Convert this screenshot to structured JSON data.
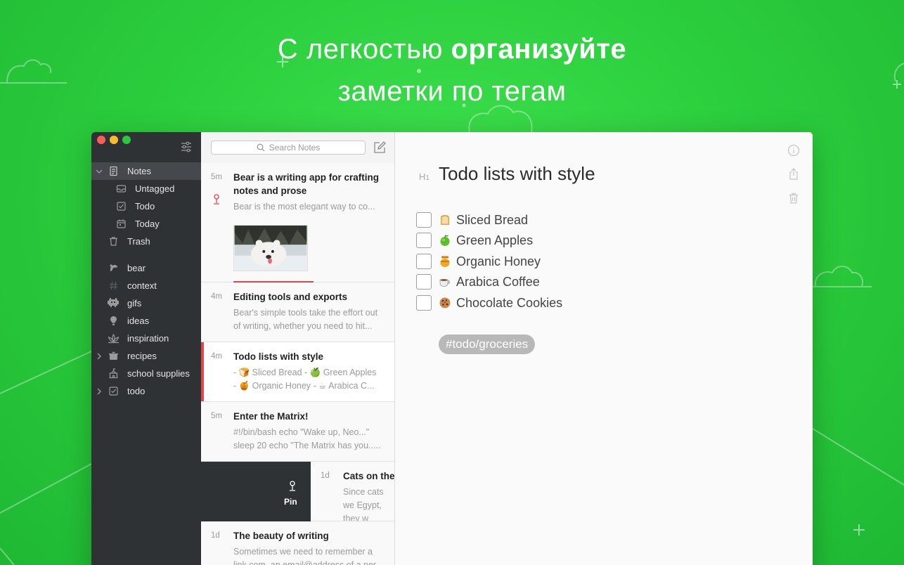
{
  "headline": {
    "line1_regular": "С легкостью ",
    "line1_bold": "организуйте",
    "line2": "заметки по тегам"
  },
  "sidebar": {
    "items": [
      {
        "label": "Notes",
        "icon": "note-icon"
      },
      {
        "label": "Untagged",
        "icon": "inbox-icon"
      },
      {
        "label": "Todo",
        "icon": "checkbox-icon"
      },
      {
        "label": "Today",
        "icon": "calendar-icon"
      },
      {
        "label": "Trash",
        "icon": "trash-icon"
      },
      {
        "label": "bear",
        "icon": "bear-icon"
      },
      {
        "label": "context",
        "icon": "hash-icon"
      },
      {
        "label": "gifs",
        "icon": "space-invader-icon"
      },
      {
        "label": "ideas",
        "icon": "lightbulb-icon"
      },
      {
        "label": "inspiration",
        "icon": "lotus-icon"
      },
      {
        "label": "recipes",
        "icon": "pot-icon"
      },
      {
        "label": "school supplies",
        "icon": "school-icon"
      },
      {
        "label": "todo",
        "icon": "checkbox-icon"
      }
    ]
  },
  "list": {
    "search_placeholder": "Search Notes",
    "notes": [
      {
        "time": "5m",
        "title": "Bear is a writing app for crafting notes and prose",
        "snippet": "Bear is the most elegant way to co..."
      },
      {
        "time": "4m",
        "title": "Editing tools and exports",
        "snippet": "Bear's simple tools take the effort out of writing, whether you need to hit..."
      },
      {
        "time": "4m",
        "title": "Todo lists with style",
        "snippet1": "- 🍞 Sliced Bread - 🍏 Green Apples",
        "snippet2": "- 🍯 Organic Honey - ☕ Arabica C..."
      },
      {
        "time": "5m",
        "title": "Enter the Matrix!",
        "snippet": "#!/bin/bash echo \"Wake up, Neo...\" sleep 20 echo \"The Matrix has you....."
      },
      {
        "time": "1d",
        "title": "Cats on the",
        "snippet": "Since cats we Egypt, they w"
      },
      {
        "time": "1d",
        "title": "The beauty of writing",
        "snippet": "Sometimes we need to remember a link.com, an email@address of a per"
      }
    ],
    "pin_label": "Pin"
  },
  "editor": {
    "heading_marker": "H",
    "heading_level": "1",
    "title": "Todo lists with style",
    "todos": [
      {
        "text": "Sliced Bread",
        "icon": "bread-icon"
      },
      {
        "text": "Green Apples",
        "icon": "green-apple-icon"
      },
      {
        "text": "Organic Honey",
        "icon": "honey-pot-icon"
      },
      {
        "text": "Arabica Coffee",
        "icon": "coffee-icon"
      },
      {
        "text": "Chocolate Cookies",
        "icon": "cookie-icon"
      }
    ],
    "tag": "#todo/groceries"
  },
  "colors": {
    "background": "#2ccf3d",
    "sidebar": "#2f3235",
    "accent_red": "#e0474c",
    "tag": "#b8b8b8"
  }
}
